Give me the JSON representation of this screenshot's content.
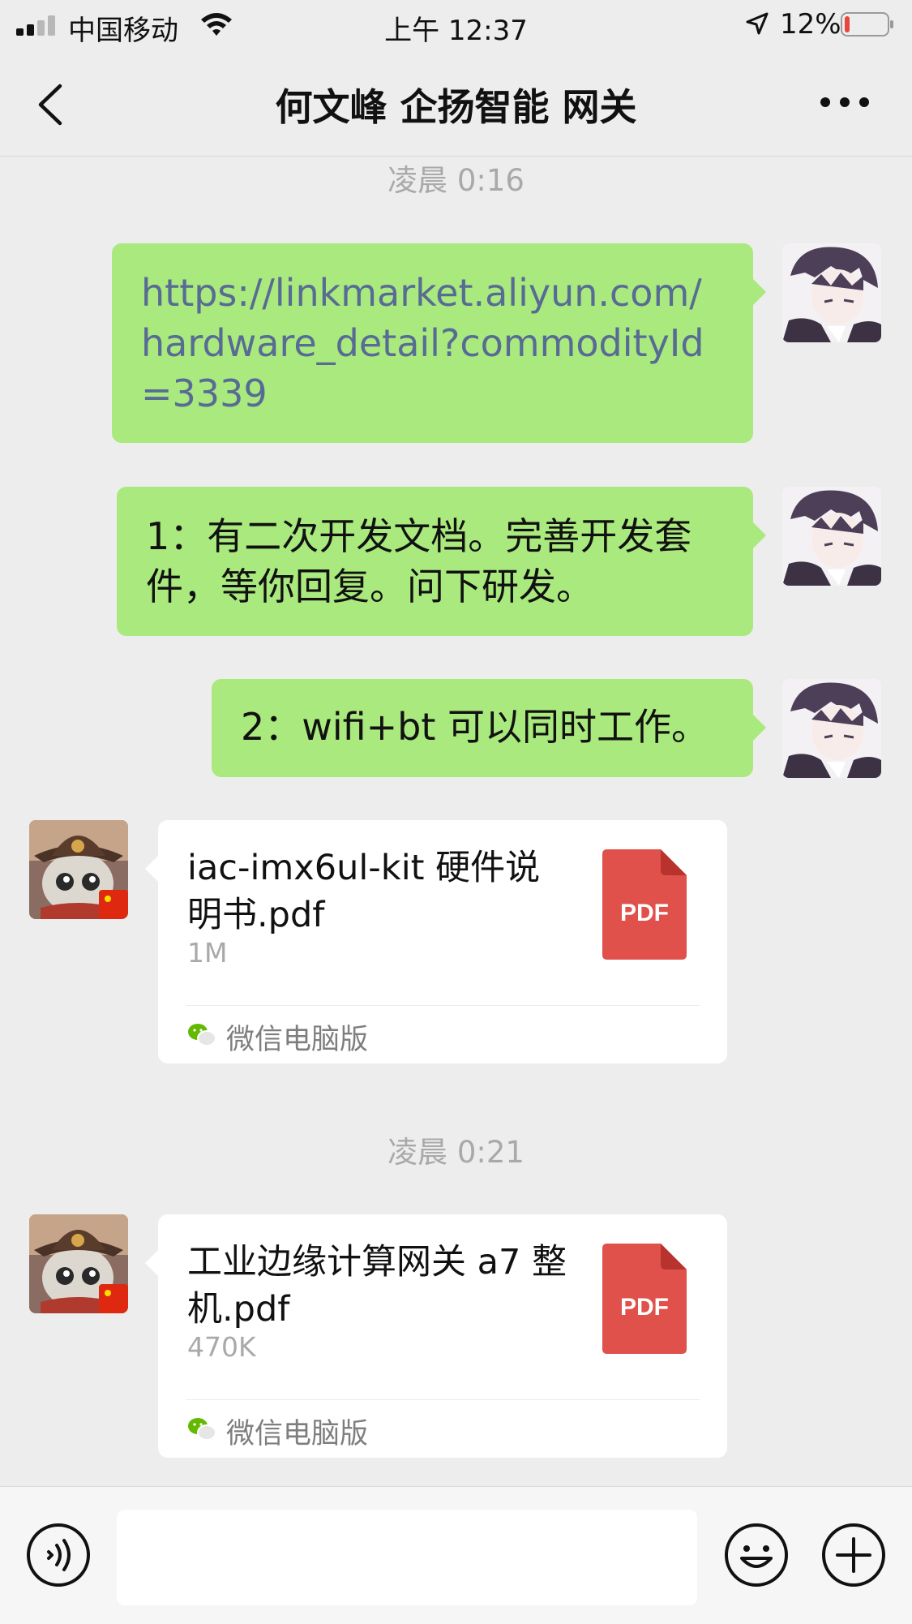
{
  "status_bar": {
    "carrier": "中国移动",
    "time": "上午 12:37",
    "battery_percent": "12%",
    "battery_level": 0.12,
    "battery_color": "#e8453c"
  },
  "nav": {
    "title": "何文峰 企扬智能 网关",
    "back_icon": "chevron-left-icon",
    "more_icon": "more-dots-icon"
  },
  "messages": {
    "timestamp_1": "凌晨 0:16",
    "msg_1": "https://linkmarket.aliyun.com/hardware_detail?commodityId=3339",
    "msg_2": "1：有二次开发文档。完善开发套件，等你回复。问下研发。",
    "msg_3": "2：wifi+bt 可以同时工作。",
    "file_1": {
      "name": "iac-imx6ul-kit 硬件说明书.pdf",
      "size": "1M",
      "icon_label": "PDF",
      "source": "微信电脑版"
    },
    "timestamp_2": "凌晨 0:21",
    "file_2": {
      "name": "工业边缘计算网关 a7 整机.pdf",
      "size": "470K",
      "icon_label": "PDF",
      "source": "微信电脑版"
    }
  },
  "input_bar": {
    "placeholder": "",
    "voice_icon": "voice-icon",
    "emoji_icon": "emoji-icon",
    "plus_icon": "plus-icon"
  },
  "colors": {
    "my_bubble": "#a9e97d",
    "link": "#576b95",
    "pdf_icon": "#e0514b",
    "background": "#ededed"
  }
}
